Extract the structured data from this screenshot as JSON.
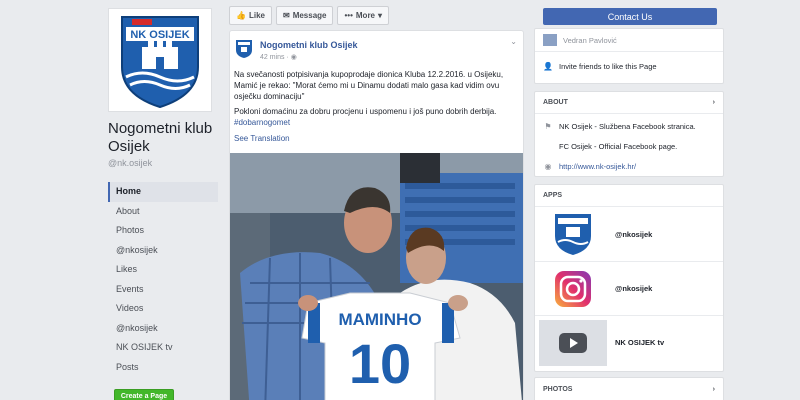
{
  "page": {
    "name": "Nogometni klub Osijek",
    "handle": "@nk.osijek",
    "logo_text": "NK OSIJEK"
  },
  "nav": {
    "items": [
      "Home",
      "About",
      "Photos",
      "@nkosijek",
      "Likes",
      "Events",
      "Videos",
      "@nkosijek",
      "NK OSIJEK tv",
      "Posts"
    ],
    "create_page": "Create a Page"
  },
  "actions": {
    "like": "Like",
    "message": "Message",
    "more": "More",
    "contact": "Contact Us"
  },
  "post": {
    "author": "Nogometni klub Osijek",
    "time": "42 mins",
    "text1": "Na svečanosti potpisivanja kupoprodaje dionica Kluba 12.2.2016. u Osijeku, Mamić je rekao: \"Morat ćemo mi u Dinamu dodati malo gasa kad vidim ovu osječku dominaciju\"",
    "text2": "Pokloni domaćinu za dobru procjenu i uspomenu i još puno dobrih derbija.",
    "hashtag": "#dobarnogomet",
    "see_translation": "See Translation",
    "shirt_name": "MAMINHO",
    "shirt_number": "10"
  },
  "sidebar": {
    "friend_name": "Vedran Pavlović",
    "invite_text": "Invite friends to like this Page",
    "about_title": "ABOUT",
    "about_rows": [
      "NK Osijek - Službena Facebook stranica.",
      "FC Osijek - Official Facebook page.",
      "http://www.nk-osijek.hr/"
    ],
    "apps_title": "APPS",
    "apps": [
      "@nkosijek",
      "@nkosijek",
      "NK OSIJEK tv"
    ],
    "photos_title": "PHOTOS"
  },
  "colors": {
    "brand_blue": "#4267b2",
    "link_blue": "#365899",
    "green": "#42b72a"
  }
}
